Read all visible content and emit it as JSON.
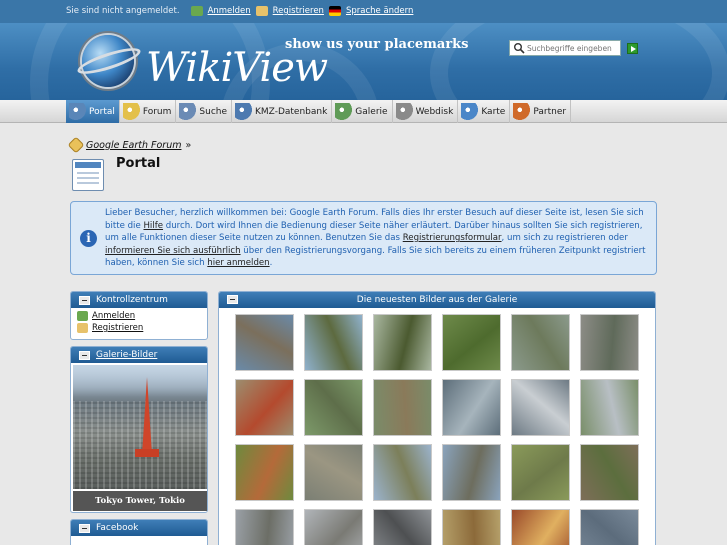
{
  "topbar": {
    "status": "Sie sind nicht angemeldet.",
    "login": "Anmelden",
    "register": "Registrieren",
    "language": "Sprache ändern"
  },
  "header": {
    "logo": "WikiView",
    "tagline": "show us your placemarks",
    "search_placeholder": "Suchbegriffe eingeben"
  },
  "nav": [
    {
      "label": "Portal",
      "icon": "portal-icon",
      "active": true
    },
    {
      "label": "Forum",
      "icon": "forum-icon"
    },
    {
      "label": "Suche",
      "icon": "search-icon"
    },
    {
      "label": "KMZ-Datenbank",
      "icon": "database-icon"
    },
    {
      "label": "Galerie",
      "icon": "gallery-icon"
    },
    {
      "label": "Webdisk",
      "icon": "webdisk-icon"
    },
    {
      "label": "Karte",
      "icon": "map-icon"
    },
    {
      "label": "Partner",
      "icon": "partner-icon"
    }
  ],
  "breadcrumb": {
    "label": "Google Earth Forum",
    "sep": "»"
  },
  "page_title": "Portal",
  "info": {
    "p1": "Lieber Besucher, herzlich willkommen bei: Google Earth Forum. Falls dies Ihr erster Besuch auf dieser Seite ist, lesen Sie sich bitte die ",
    "help": "Hilfe",
    "p2": " durch. Dort wird Ihnen die Bedienung dieser Seite näher erläutert. Darüber hinaus sollten Sie sich registrieren, um alle Funktionen dieser Seite nutzen zu können. Benutzen Sie das ",
    "form": "Registrierungsformular",
    "p3": ", um sich zu registrieren oder ",
    "inform": "informieren Sie sich ausführlich",
    "p4": " über den Registrierungsvorgang. Falls Sie sich bereits zu einem früheren Zeitpunkt registriert haben, können Sie sich ",
    "login_here": "hier anmelden",
    "p5": "."
  },
  "sidebar": {
    "control": {
      "title": "Kontrollzentrum",
      "login": "Anmelden",
      "register": "Registrieren"
    },
    "gallery": {
      "title": "Galerie-Bilder",
      "caption": "Tokyo Tower, Tokio"
    },
    "facebook": {
      "title": "Facebook"
    }
  },
  "gallery": {
    "title": "Die neuesten Bilder aus der Galerie",
    "thumbs": [
      {
        "c1": "#6a8aa8",
        "c2": "#7b6f5c"
      },
      {
        "c1": "#8fb1cc",
        "c2": "#5d6a3f"
      },
      {
        "c1": "#a9b7a0",
        "c2": "#4b5a30"
      },
      {
        "c1": "#6e8a4a",
        "c2": "#4e6b2e"
      },
      {
        "c1": "#8b9a8c",
        "c2": "#6d7a5c"
      },
      {
        "c1": "#8c8c86",
        "c2": "#5f6a5a"
      },
      {
        "c1": "#9c8d6e",
        "c2": "#b44a2e"
      },
      {
        "c1": "#7d9a6a",
        "c2": "#5e6e4a"
      },
      {
        "c1": "#7a8c6a",
        "c2": "#8a7a5a"
      },
      {
        "c1": "#5d6e7a",
        "c2": "#a6b4bc"
      },
      {
        "c1": "#6d7a84",
        "c2": "#c9ced2"
      },
      {
        "c1": "#7a8f6a",
        "c2": "#b8bfc4"
      },
      {
        "c1": "#6e8a3e",
        "c2": "#b46a3a"
      },
      {
        "c1": "#7b7f74",
        "c2": "#9b9682"
      },
      {
        "c1": "#9bb3cc",
        "c2": "#7c7f5a"
      },
      {
        "c1": "#8aa3bc",
        "c2": "#6d6d5e"
      },
      {
        "c1": "#8a9a5a",
        "c2": "#6e7a4a"
      },
      {
        "c1": "#7d6e58",
        "c2": "#5c6e3e"
      },
      {
        "c1": "#9aa0a6",
        "c2": "#6c6e66"
      },
      {
        "c1": "#b0b4b8",
        "c2": "#7a7a74"
      },
      {
        "c1": "#8e9296",
        "c2": "#4e5052"
      },
      {
        "c1": "#b5a06a",
        "c2": "#8c6a3a"
      },
      {
        "c1": "#9a4a2a",
        "c2": "#e0b060"
      },
      {
        "c1": "#7a8a9a",
        "c2": "#5c6c7c"
      }
    ]
  }
}
